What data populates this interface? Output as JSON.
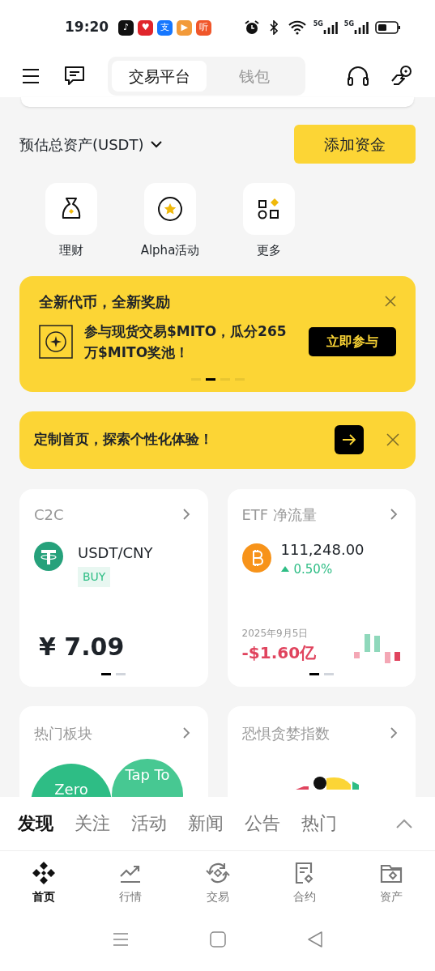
{
  "status_bar": {
    "time": "19:20",
    "apps": [
      {
        "glyph": "♪",
        "color": "#111111"
      },
      {
        "glyph": "♥",
        "color": "#e0252b"
      },
      {
        "glyph": "支",
        "color": "#1677ff"
      },
      {
        "glyph": "▶",
        "color": "#f29a3a"
      },
      {
        "glyph": "听",
        "color": "#f0562a"
      }
    ],
    "network": [
      "5G",
      "5G"
    ]
  },
  "header": {
    "tabs": [
      {
        "label": "交易平台",
        "selected": true
      },
      {
        "label": "钱包",
        "selected": false
      }
    ]
  },
  "assets": {
    "label": "预估总资产(USDT)",
    "button": "添加资金"
  },
  "shortcuts": [
    {
      "label": "理财",
      "kind": "bag"
    },
    {
      "label": "Alpha活动",
      "kind": "star"
    },
    {
      "label": "更多",
      "kind": "grid"
    }
  ],
  "promo": {
    "title": "全新代币，全新奖励",
    "text": "参与现货交易$MITO，瓜分265万$MITO奖池！",
    "button": "立即参与",
    "pages": [
      false,
      true,
      false,
      false
    ]
  },
  "customize": {
    "text": "定制首页，探索个性化体验！"
  },
  "c2c": {
    "title": "C2C",
    "pair": "USDT/CNY",
    "side": "BUY",
    "price": "¥ 7.09",
    "pages": [
      true,
      false
    ]
  },
  "etf": {
    "title": "ETF 净流量",
    "price": "111,248.00",
    "change": "0.50%",
    "date": "2025年9月5日",
    "flow": "-$1.60亿",
    "pages": [
      true,
      false
    ]
  },
  "sectors": {
    "title": "热门板块",
    "bubbles": [
      "Zero",
      "Tap To"
    ]
  },
  "fear_greed": {
    "title": "恐惧贪婪指数"
  },
  "feed_tabs": [
    {
      "label": "发现",
      "selected": true
    },
    {
      "label": "关注",
      "selected": false
    },
    {
      "label": "活动",
      "selected": false
    },
    {
      "label": "新闻",
      "selected": false
    },
    {
      "label": "公告",
      "selected": false
    },
    {
      "label": "热门",
      "selected": false
    }
  ],
  "bottom_nav": [
    {
      "label": "首页",
      "selected": true,
      "kind": "home"
    },
    {
      "label": "行情",
      "selected": false,
      "kind": "chart"
    },
    {
      "label": "交易",
      "selected": false,
      "kind": "trade"
    },
    {
      "label": "合约",
      "selected": false,
      "kind": "doc"
    },
    {
      "label": "资产",
      "selected": false,
      "kind": "wallet"
    }
  ]
}
